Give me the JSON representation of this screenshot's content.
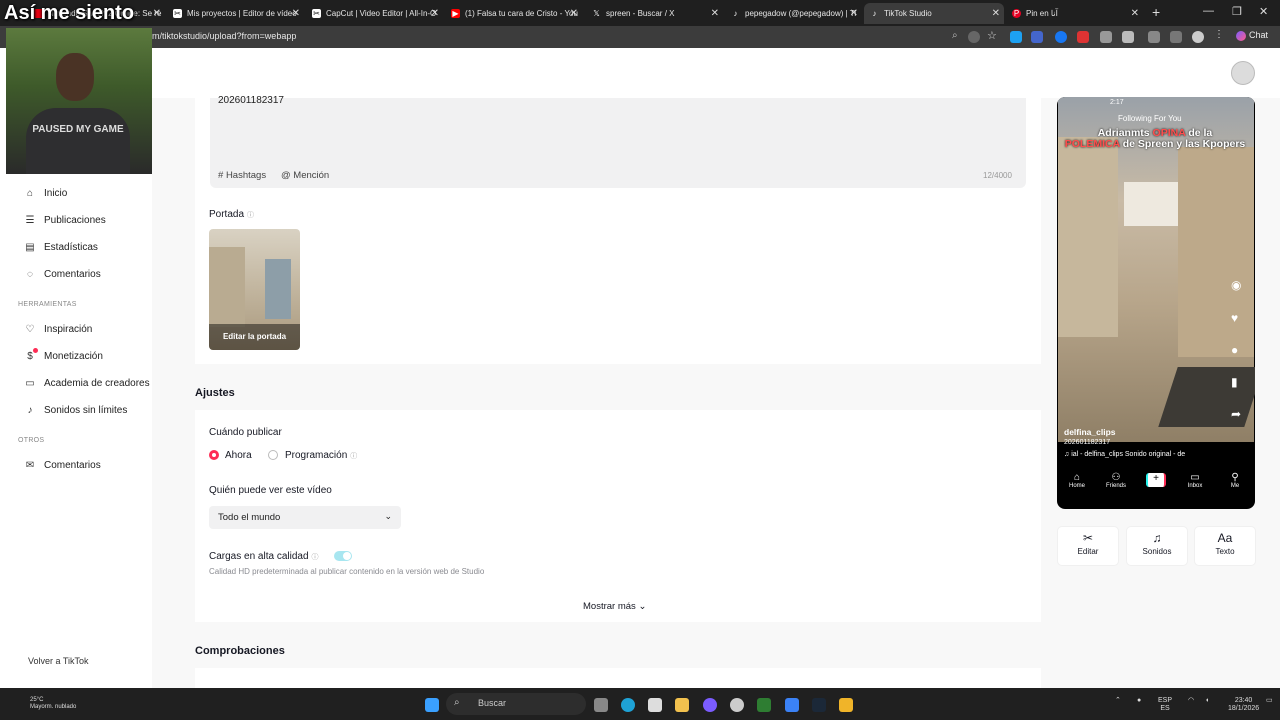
{
  "overlay": {
    "title": "Así me siento",
    "shirt_text": "PAUSED MY GAME",
    "back_to_tiktok": "Volver a TikTok"
  },
  "browser": {
    "tabs": [
      {
        "label": "Nintendo Switch 2 Online: Se re",
        "icon": "nintendo-icon"
      },
      {
        "label": "Mis proyectos | Editor de vídeo",
        "icon": "capcut-icon"
      },
      {
        "label": "CapCut | Video Editor | All-In-O",
        "icon": "capcut-icon"
      },
      {
        "label": "(1) Falsa tu cara de Cristo - You",
        "icon": "youtube-icon"
      },
      {
        "label": "spreen - Buscar / X",
        "icon": "x-icon"
      },
      {
        "label": "pepegadow (@pepegadow) | Ti",
        "icon": "tiktok-icon"
      },
      {
        "label": "TikTok Studio",
        "icon": "tiktok-icon"
      },
      {
        "label": "Pin en آنا",
        "icon": "pinterest-icon"
      }
    ],
    "url": "m/tiktokstudio/upload?from=webapp",
    "chat_label": "Chat"
  },
  "sidebar": {
    "items": [
      {
        "label": "Inicio",
        "icon": "home-icon"
      },
      {
        "label": "Publicaciones",
        "icon": "posts-icon"
      },
      {
        "label": "Estadísticas",
        "icon": "stats-icon"
      },
      {
        "label": "Comentarios",
        "icon": "comments-icon"
      }
    ],
    "tools_header": "HERRAMIENTAS",
    "tools": [
      {
        "label": "Inspiración",
        "icon": "bulb-icon"
      },
      {
        "label": "Monetización",
        "icon": "money-icon"
      },
      {
        "label": "Academia de creadores",
        "icon": "academy-icon"
      },
      {
        "label": "Sonidos sin límites",
        "icon": "music-icon"
      }
    ],
    "others_header": "OTROS",
    "others": [
      {
        "label": "Comentarios",
        "icon": "feedback-icon"
      }
    ]
  },
  "upload": {
    "caption": "202601182317",
    "hashtags_label": "Hashtags",
    "mention_label": "Mención",
    "counter": "12/4000",
    "cover_label": "Portada",
    "edit_cover": "Editar la portada",
    "settings_title": "Ajustes",
    "when_label": "Cuándo publicar",
    "now_label": "Ahora",
    "schedule_label": "Programación",
    "who_label": "Quién puede ver este vídeo",
    "who_value": "Todo el mundo",
    "hq_label": "Cargas en alta calidad",
    "hq_on": true,
    "hq_sub": "Calidad HD predeterminada al publicar contenido en la versión web de Studio",
    "show_more": "Mostrar más",
    "checks_title": "Comprobaciones"
  },
  "preview": {
    "time": "2:17",
    "tabs": "Following   For You",
    "title_pre": "Adrianmts ",
    "title_red": "OPINA",
    "title_mid": " de la ",
    "title_red2": "POLEMICA",
    "title_post": " de Spreen y las Kpopers",
    "username": "delfina_clips",
    "caption": "202601182317",
    "sound": "♫ ial - delfina_clips   Sonido original - de",
    "nav": [
      "Home",
      "Friends",
      "Inbox",
      "Me"
    ],
    "tools": [
      {
        "label": "Editar",
        "icon": "scissors-icon"
      },
      {
        "label": "Sonidos",
        "icon": "note-icon"
      },
      {
        "label": "Texto",
        "icon": "text-icon"
      }
    ]
  },
  "taskbar": {
    "search": "Buscar",
    "lang_top": "ESP",
    "lang_bottom": "ES",
    "time": "23:40",
    "date": "18/1/2026",
    "weather_temp": "25°C",
    "weather_desc": "Mayorm. nublado"
  }
}
